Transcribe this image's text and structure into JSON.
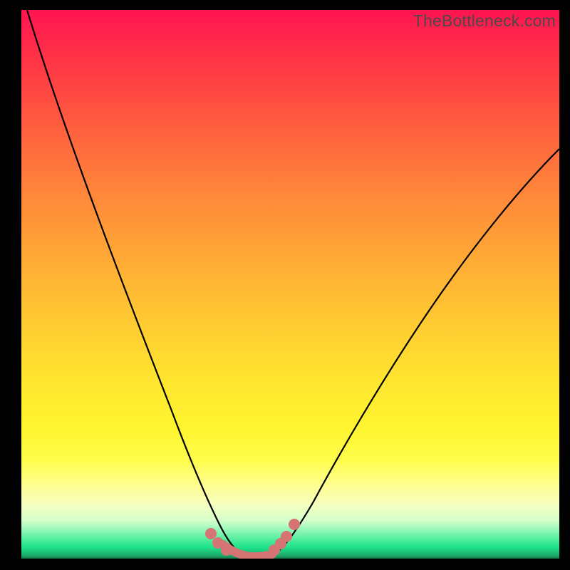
{
  "watermark": "TheBottleneck.com",
  "chart_data": {
    "type": "line",
    "title": "",
    "xlabel": "",
    "ylabel": "",
    "xlim": [
      0,
      100
    ],
    "ylim": [
      0,
      100
    ],
    "grid": false,
    "legend": false,
    "series": [
      {
        "name": "left-curve",
        "x": [
          1,
          5,
          10,
          15,
          20,
          25,
          28,
          30,
          32,
          34,
          35.5,
          37,
          38.5,
          40
        ],
        "y": [
          100,
          88,
          74,
          60,
          46,
          30,
          20,
          14,
          9,
          5,
          3,
          1.6,
          0.8,
          0.3
        ]
      },
      {
        "name": "right-curve",
        "x": [
          46,
          48,
          50,
          52,
          55,
          58,
          62,
          66,
          70,
          75,
          80,
          85,
          90,
          95,
          100
        ],
        "y": [
          0.5,
          2,
          5,
          8,
          13,
          18,
          25,
          32,
          38,
          46,
          53,
          60,
          66,
          71,
          76
        ]
      },
      {
        "name": "valley-floor",
        "x": [
          38,
          40,
          42,
          44,
          46,
          48
        ],
        "y": [
          0.3,
          0.2,
          0.15,
          0.15,
          0.2,
          0.3
        ]
      }
    ],
    "markers": [
      {
        "x": 34.5,
        "y": 4.2
      },
      {
        "x": 36.0,
        "y": 2.5
      },
      {
        "x": 37.3,
        "y": 1.3
      },
      {
        "x": 46.2,
        "y": 1.2
      },
      {
        "x": 47.3,
        "y": 2.3
      },
      {
        "x": 48.2,
        "y": 3.6
      },
      {
        "x": 49.8,
        "y": 5.8
      }
    ],
    "background_gradient": {
      "top": "#ff1450",
      "mid": "#ffe62f",
      "bottom": "#1ee28a"
    }
  }
}
